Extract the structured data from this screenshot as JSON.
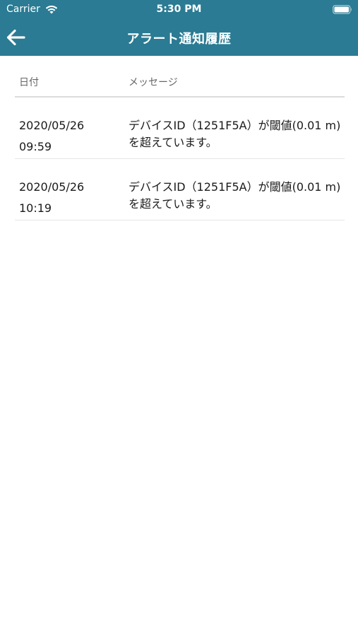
{
  "status_bar": {
    "carrier": "Carrier",
    "time": "5:30 PM"
  },
  "nav": {
    "title": "アラート通知履歴",
    "back_icon": "arrow-left-icon",
    "color": "#2a7b93"
  },
  "table": {
    "headers": {
      "date": "日付",
      "message": "メッセージ"
    },
    "rows": [
      {
        "date": "2020/05/26 09:59",
        "message": "デバイスID（1251F5A）が閾値(0.01 m)を超えています。"
      },
      {
        "date": "2020/05/26 10:19",
        "message": "デバイスID（1251F5A）が閾値(0.01 m)を超えています。"
      }
    ]
  }
}
